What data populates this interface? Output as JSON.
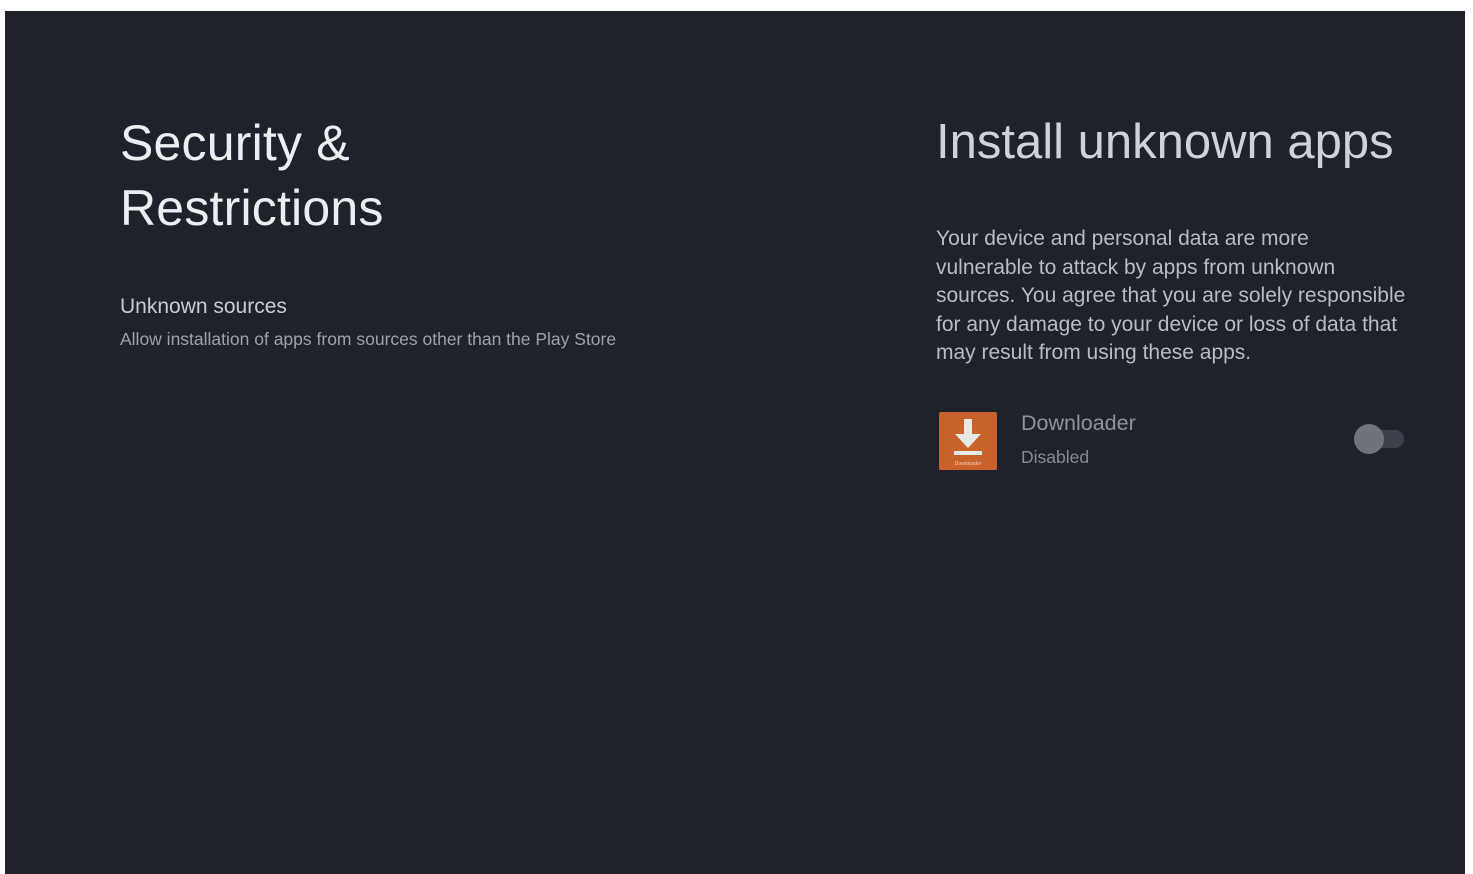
{
  "left_pane": {
    "title_line1": "Security &",
    "title_line2": "Restrictions",
    "unknown_sources": {
      "title": "Unknown sources",
      "description": "Allow installation of apps from sources other than the Play Store"
    }
  },
  "right_pane": {
    "title": "Install unknown apps",
    "description": "Your device and personal data are more vulnerable to attack by apps from unknown sources. You agree that you are solely responsible for any damage to your device or loss of data that may result from using these apps.",
    "apps": [
      {
        "name": "Downloader",
        "status": "Disabled",
        "icon": "downloader-app-icon",
        "icon_caption": "Downloader",
        "enabled": false
      }
    ]
  },
  "colors": {
    "background": "#1f212b",
    "app_icon": "#c8622a",
    "toggle_off_thumb": "#70737c",
    "toggle_off_track": "#3e414b"
  }
}
